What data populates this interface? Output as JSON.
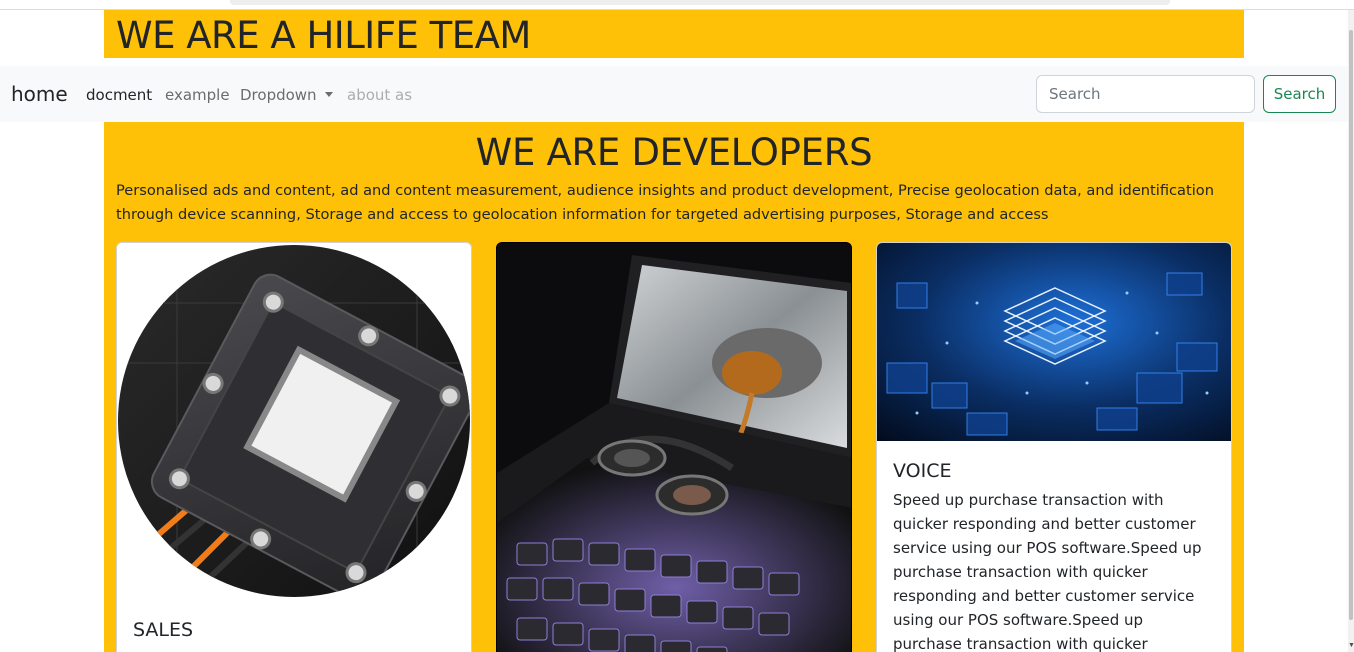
{
  "hero": {
    "title": "WE ARE A HILIFE TEAM"
  },
  "navbar": {
    "brand": "home",
    "links": [
      {
        "label": "docment",
        "state": "active"
      },
      {
        "label": "example",
        "state": "normal"
      },
      {
        "label": "Dropdown",
        "state": "normal"
      },
      {
        "label": "about as",
        "state": "disabled"
      }
    ],
    "search": {
      "placeholder": "Search",
      "value": "",
      "button_label": "Search"
    }
  },
  "main": {
    "heading": "WE ARE DEVELOPERS",
    "intro": "Personalised ads and content, ad and content measurement, audience insights and product development, Precise geolocation data, and identification through device scanning, Storage and access to geolocation information for targeted advertising purposes, Storage and access",
    "cards": [
      {
        "title": "SALES",
        "text": "",
        "image_subject": "thermoelectric-cooler-module-photo"
      },
      {
        "title": "",
        "text": "",
        "image_subject": "laptop-keyboard-headphones-photo"
      },
      {
        "title": "VOICE",
        "text": "Speed up purchase transaction with quicker responding and better customer service using our POS software.Speed up purchase transaction with quicker responding and better customer service using our POS software.Speed up purchase transaction with quicker responding and better customer",
        "image_subject": "blue-circuit-chip-photo"
      }
    ]
  },
  "colors": {
    "accent": "#ffc107",
    "navbar_bg": "#f8f9fa",
    "success": "#198754"
  }
}
